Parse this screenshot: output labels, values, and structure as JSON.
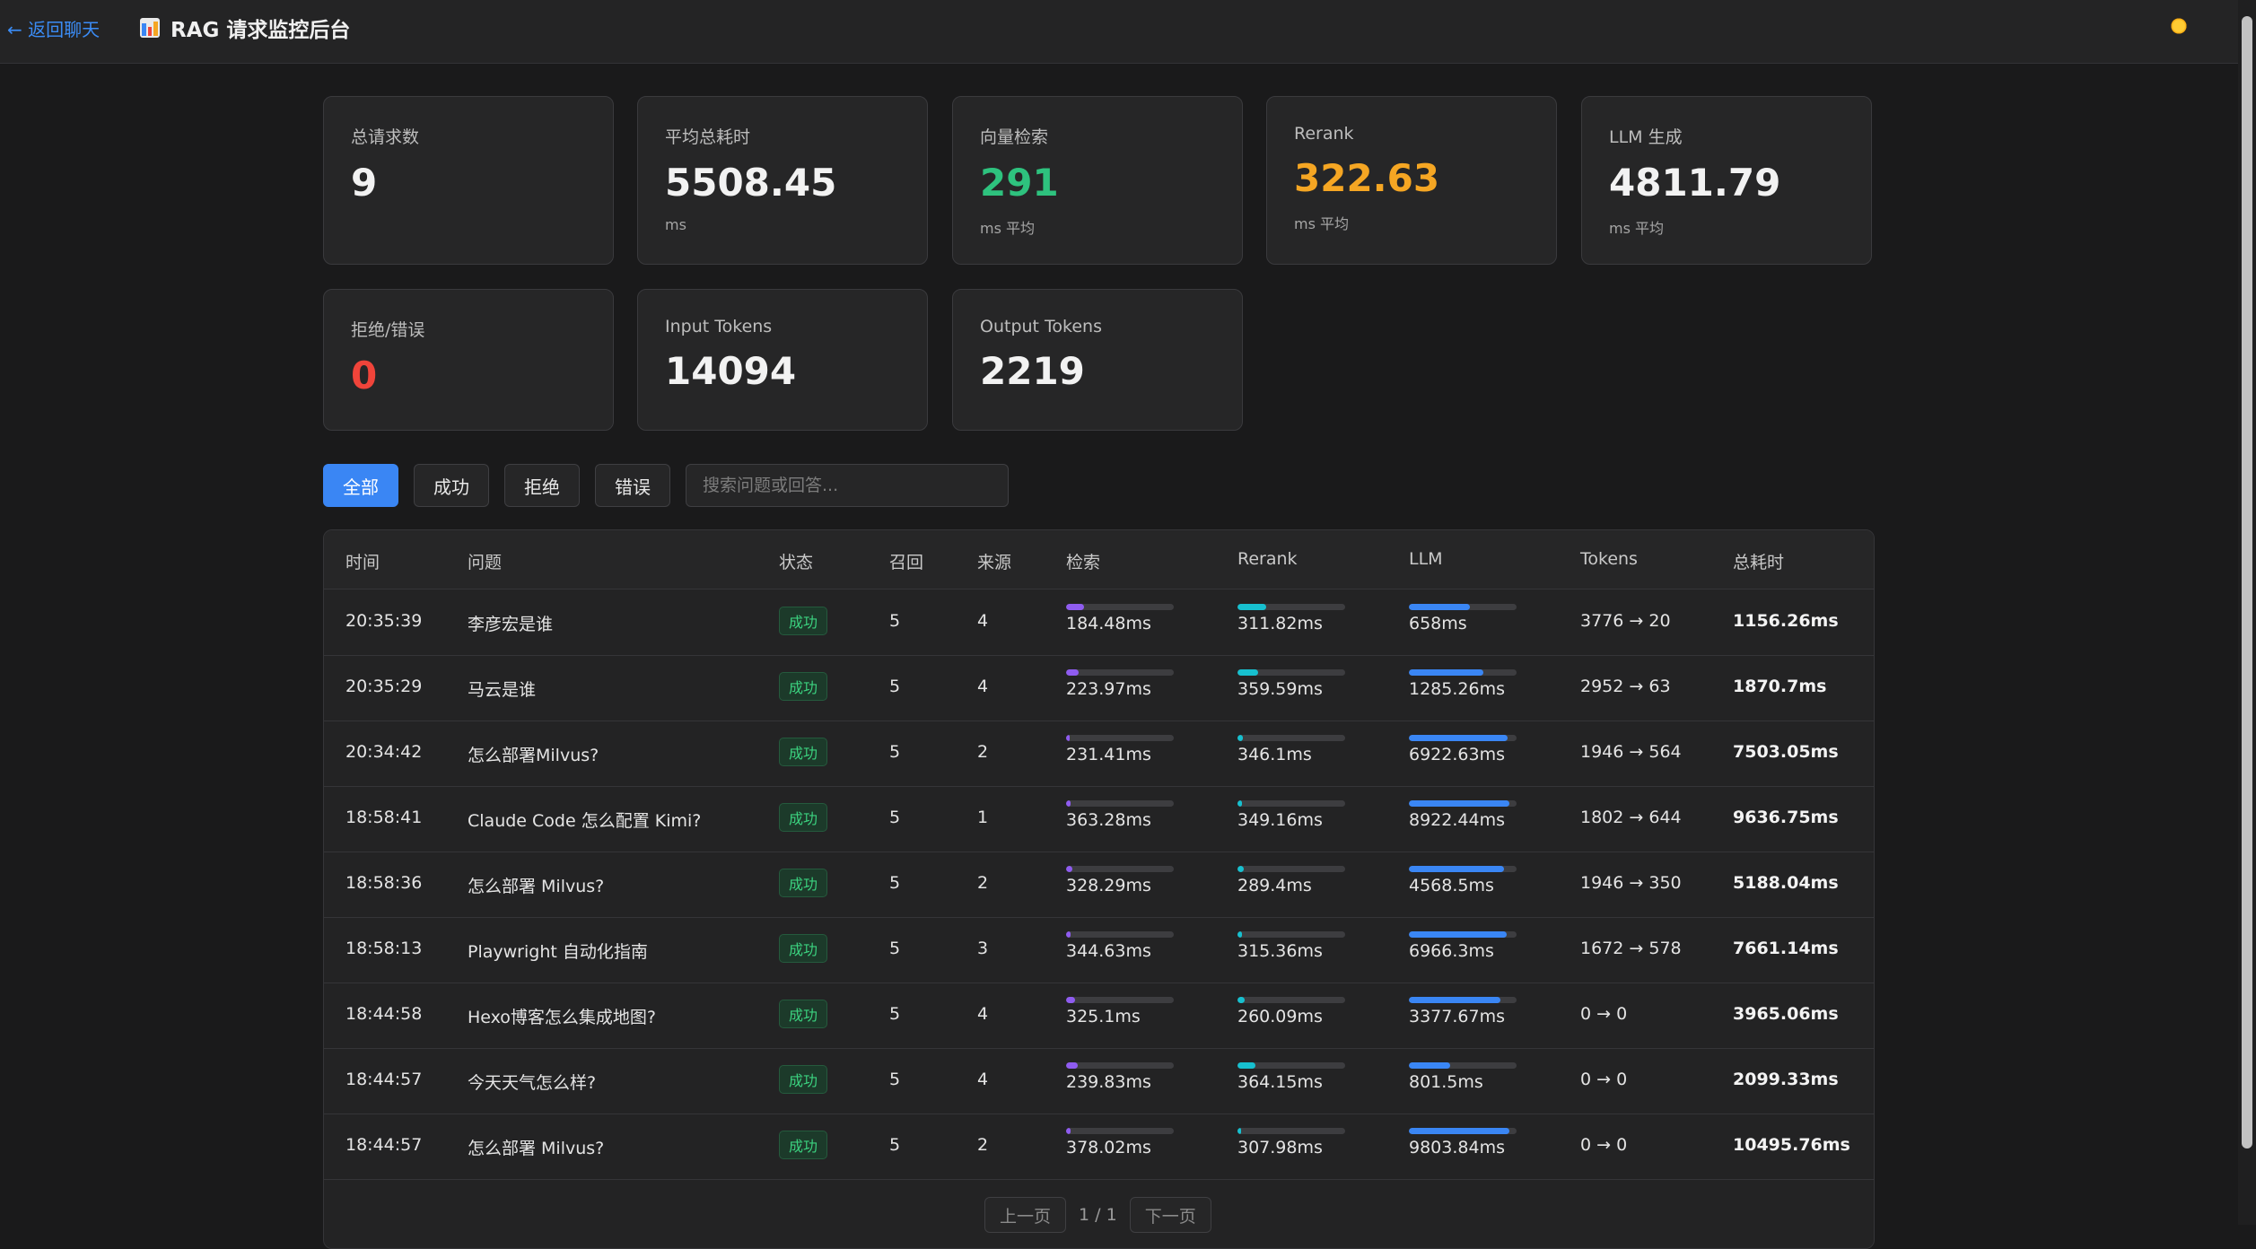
{
  "header": {
    "back_label": "← 返回聊天",
    "title": "RAG 请求监控后台",
    "icon": "bar-chart-icon",
    "theme_icon": "sun-icon"
  },
  "stats": [
    {
      "label": "总请求数",
      "value": "9",
      "unit": ""
    },
    {
      "label": "平均总耗时",
      "value": "5508.45",
      "unit": "ms"
    },
    {
      "label": "向量检索",
      "value": "291",
      "unit": "ms 平均"
    },
    {
      "label": "Rerank",
      "value": "322.63",
      "unit": "ms 平均"
    },
    {
      "label": "LLM 生成",
      "value": "4811.79",
      "unit": "ms 平均"
    },
    {
      "label": "拒绝/错误",
      "value": "0",
      "unit": ""
    },
    {
      "label": "Input Tokens",
      "value": "14094",
      "unit": ""
    },
    {
      "label": "Output Tokens",
      "value": "2219",
      "unit": ""
    }
  ],
  "filters": {
    "all": "全部",
    "success": "成功",
    "reject": "拒绝",
    "error": "错误",
    "search_placeholder": "搜索问题或回答..."
  },
  "table": {
    "headers": {
      "time": "时间",
      "question": "问题",
      "status": "状态",
      "recall": "召回",
      "source": "来源",
      "retrieval": "检索",
      "rerank": "Rerank",
      "llm": "LLM",
      "tokens": "Tokens",
      "total": "总耗时"
    },
    "rows": [
      {
        "time": "20:35:39",
        "question": "李彦宏是谁",
        "status": "成功",
        "recall": "5",
        "source": "4",
        "retrieval": "184.48ms",
        "retrieval_pct": 0.17,
        "rerank": "311.82ms",
        "rerank_pct": 0.27,
        "llm": "658ms",
        "llm_pct": 0.57,
        "tokens": "3776 → 20",
        "total": "1156.26ms"
      },
      {
        "time": "20:35:29",
        "question": "马云是谁",
        "status": "成功",
        "recall": "5",
        "source": "4",
        "retrieval": "223.97ms",
        "retrieval_pct": 0.12,
        "rerank": "359.59ms",
        "rerank_pct": 0.19,
        "llm": "1285.26ms",
        "llm_pct": 0.69,
        "tokens": "2952 → 63",
        "total": "1870.7ms"
      },
      {
        "time": "20:34:42",
        "question": "怎么部署Milvus?",
        "status": "成功",
        "recall": "5",
        "source": "2",
        "retrieval": "231.41ms",
        "retrieval_pct": 0.03,
        "rerank": "346.1ms",
        "rerank_pct": 0.05,
        "llm": "6922.63ms",
        "llm_pct": 0.92,
        "tokens": "1946 → 564",
        "total": "7503.05ms"
      },
      {
        "time": "18:58:41",
        "question": "Claude Code 怎么配置 Kimi?",
        "status": "成功",
        "recall": "5",
        "source": "1",
        "retrieval": "363.28ms",
        "retrieval_pct": 0.04,
        "rerank": "349.16ms",
        "rerank_pct": 0.04,
        "llm": "8922.44ms",
        "llm_pct": 0.93,
        "tokens": "1802 → 644",
        "total": "9636.75ms"
      },
      {
        "time": "18:58:36",
        "question": "怎么部署 Milvus?",
        "status": "成功",
        "recall": "5",
        "source": "2",
        "retrieval": "328.29ms",
        "retrieval_pct": 0.06,
        "rerank": "289.4ms",
        "rerank_pct": 0.06,
        "llm": "4568.5ms",
        "llm_pct": 0.88,
        "tokens": "1946 → 350",
        "total": "5188.04ms"
      },
      {
        "time": "18:58:13",
        "question": "Playwright 自动化指南",
        "status": "成功",
        "recall": "5",
        "source": "3",
        "retrieval": "344.63ms",
        "retrieval_pct": 0.04,
        "rerank": "315.36ms",
        "rerank_pct": 0.04,
        "llm": "6966.3ms",
        "llm_pct": 0.91,
        "tokens": "1672 → 578",
        "total": "7661.14ms"
      },
      {
        "time": "18:44:58",
        "question": "Hexo博客怎么集成地图?",
        "status": "成功",
        "recall": "5",
        "source": "4",
        "retrieval": "325.1ms",
        "retrieval_pct": 0.08,
        "rerank": "260.09ms",
        "rerank_pct": 0.07,
        "llm": "3377.67ms",
        "llm_pct": 0.85,
        "tokens": "0 → 0",
        "total": "3965.06ms"
      },
      {
        "time": "18:44:57",
        "question": "今天天气怎么样?",
        "status": "成功",
        "recall": "5",
        "source": "4",
        "retrieval": "239.83ms",
        "retrieval_pct": 0.11,
        "rerank": "364.15ms",
        "rerank_pct": 0.17,
        "llm": "801.5ms",
        "llm_pct": 0.38,
        "tokens": "0 → 0",
        "total": "2099.33ms"
      },
      {
        "time": "18:44:57",
        "question": "怎么部署 Milvus?",
        "status": "成功",
        "recall": "5",
        "source": "2",
        "retrieval": "378.02ms",
        "retrieval_pct": 0.04,
        "rerank": "307.98ms",
        "rerank_pct": 0.03,
        "llm": "9803.84ms",
        "llm_pct": 0.93,
        "tokens": "0 → 0",
        "total": "10495.76ms"
      }
    ]
  },
  "pagination": {
    "prev": "上一页",
    "info": "1 / 1",
    "next": "下一页"
  },
  "colors": {
    "accent": "#3a86f4",
    "success": "#2ec27e",
    "warning": "#f5a623",
    "danger": "#f0443a",
    "retrieval_bar": "#8f5cf0",
    "rerank_bar": "#17c0cf",
    "llm_bar": "#3a86f4"
  }
}
